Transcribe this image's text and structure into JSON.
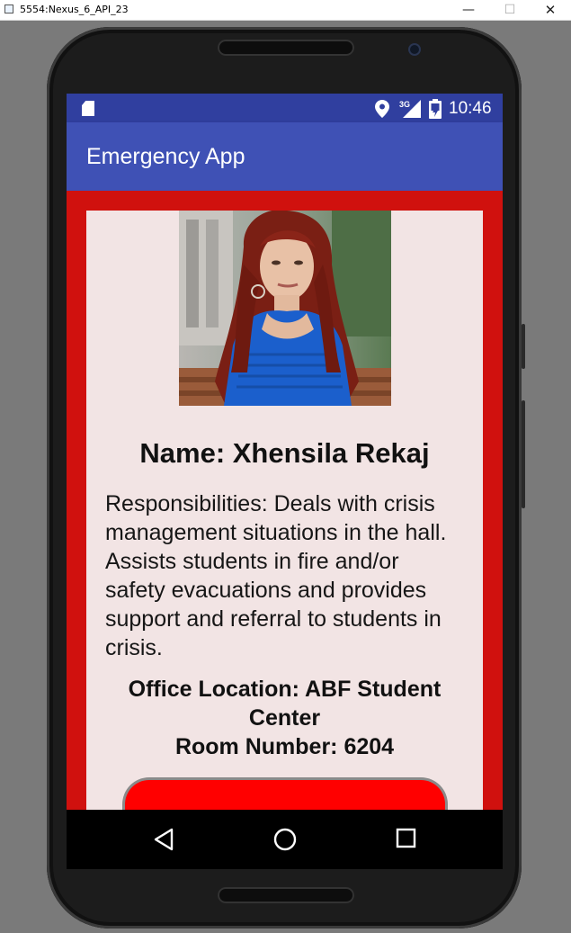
{
  "window": {
    "title": "5554:Nexus_6_API_23",
    "minimize": "—",
    "maximize": "☐",
    "close": "✕"
  },
  "status_bar": {
    "network": "3G",
    "time": "10:46",
    "icons": [
      "sd-card-icon",
      "location-icon",
      "signal-icon",
      "battery-icon"
    ]
  },
  "app_bar": {
    "title": "Emergency App",
    "color": "#3f51b5"
  },
  "profile": {
    "photo": "person-photo",
    "name": "Name: Xhensila Rekaj",
    "responsibilities": "Responsibilities: Deals with crisis management situations in the hall. Assists students in fire and/or safety evacuations and provides support and referral to students in crisis.",
    "office_location": "Office Location: ABF Student Center",
    "room_number": "Room Number: 6204"
  },
  "colors": {
    "background_red": "#d0110e",
    "card": "#f2e4e4",
    "button": "#ff0000",
    "status_bar": "#303f9f"
  },
  "nav_bar": {
    "icons": [
      "back-icon",
      "home-icon",
      "recent-apps-icon"
    ]
  }
}
